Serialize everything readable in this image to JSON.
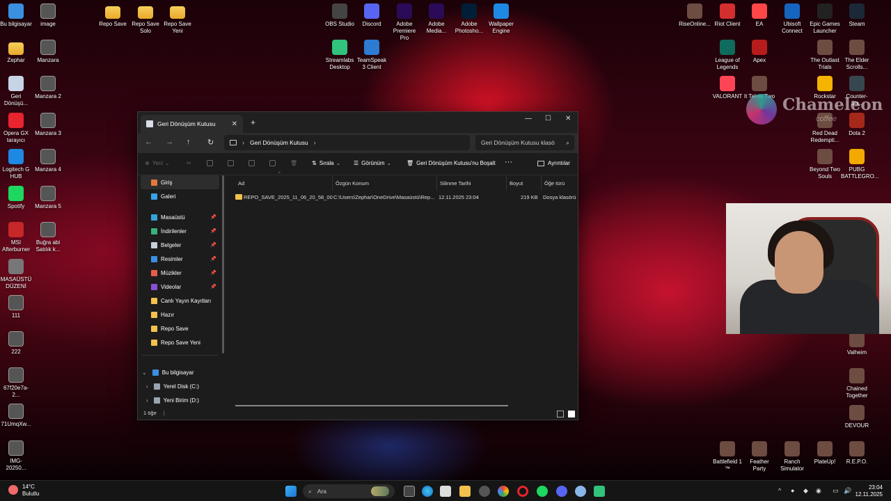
{
  "desktop": {
    "icons_left": [
      {
        "label": "Bu bilgisayar",
        "icon": "computer-icon"
      },
      {
        "label": "image",
        "icon": "image-icon"
      },
      {
        "label": "Zephar",
        "icon": "folder-icon"
      },
      {
        "label": "Manzara",
        "icon": "image-icon"
      },
      {
        "label": "Geri Dönüşü...",
        "icon": "recycle-bin-icon"
      },
      {
        "label": "Manzara 2",
        "icon": "image-icon"
      },
      {
        "label": "Opera GX tarayıcı",
        "icon": "opera-gx-icon"
      },
      {
        "label": "Manzara 3",
        "icon": "image-icon"
      },
      {
        "label": "Logitech G HUB",
        "icon": "logitech-icon"
      },
      {
        "label": "Manzara 4",
        "icon": "image-icon"
      },
      {
        "label": "Spotify",
        "icon": "spotify-icon"
      },
      {
        "label": "Manzara 5",
        "icon": "image-icon"
      },
      {
        "label": "MSI Afterburner",
        "icon": "msi-icon"
      },
      {
        "label": "Buğra abi Satılık k...",
        "icon": "image-icon"
      },
      {
        "label": "MASAÜSTÜ DÜZENİ",
        "icon": "shortcut-icon"
      },
      {
        "label": "111",
        "icon": "image-icon"
      },
      {
        "label": "222",
        "icon": "image-icon"
      },
      {
        "label": "67f20e7a-2...",
        "icon": "image-icon"
      },
      {
        "label": "71UmqXw...",
        "icon": "image-icon"
      },
      {
        "label": "IMG-20250...",
        "icon": "image-icon"
      }
    ],
    "icons_top": [
      {
        "label": "Repo Save",
        "icon": "folder-icon"
      },
      {
        "label": "Repo Save Solo",
        "icon": "folder-icon"
      },
      {
        "label": "Repo Save Yeni",
        "icon": "folder-icon"
      },
      {
        "label": "OBS Studio",
        "icon": "obs-icon"
      },
      {
        "label": "Discord",
        "icon": "discord-icon"
      },
      {
        "label": "Adobe Premiere Pro",
        "icon": "premiere-icon"
      },
      {
        "label": "Adobe Media...",
        "icon": "media-encoder-icon"
      },
      {
        "label": "Adobe Photosho...",
        "icon": "photoshop-icon"
      },
      {
        "label": "Wallpaper Engine",
        "icon": "wallpaper-engine-icon"
      },
      {
        "label": "Streamlabs Desktop",
        "icon": "streamlabs-icon"
      },
      {
        "label": "TeamSpeak 3 Client",
        "icon": "teamspeak-icon"
      }
    ],
    "icons_right": [
      {
        "label": "RiseOnline...",
        "icon": "game-icon"
      },
      {
        "label": "Riot Client",
        "icon": "riot-icon"
      },
      {
        "label": "EA",
        "icon": "ea-icon"
      },
      {
        "label": "Ubisoft Connect",
        "icon": "ubisoft-icon"
      },
      {
        "label": "Epic Games Launcher",
        "icon": "epic-icon"
      },
      {
        "label": "Steam",
        "icon": "steam-icon"
      },
      {
        "label": "League of Legends",
        "icon": "lol-icon"
      },
      {
        "label": "Apex",
        "icon": "apex-icon"
      },
      {
        "label": "The Outlast Trials",
        "icon": "game-icon"
      },
      {
        "label": "The Elder Scrolls...",
        "icon": "game-icon"
      },
      {
        "label": "VALORANT",
        "icon": "valorant-icon"
      },
      {
        "label": "It Takes Two",
        "icon": "game-icon"
      },
      {
        "label": "Rockstar",
        "icon": "rockstar-icon"
      },
      {
        "label": "Counter-Str...",
        "icon": "cs-icon"
      },
      {
        "label": "Red Dead Redempti...",
        "icon": "game-icon"
      },
      {
        "label": "Dota 2",
        "icon": "dota-icon"
      },
      {
        "label": "Beyond Two Souls",
        "icon": "game-icon"
      },
      {
        "label": "PUBG BATTLEGRO...",
        "icon": "pubg-icon"
      },
      {
        "label": "Valheim",
        "icon": "game-icon"
      },
      {
        "label": "Chained Together",
        "icon": "game-icon"
      },
      {
        "label": "DEVOUR",
        "icon": "game-icon"
      },
      {
        "label": "Battlefield 1 ™",
        "icon": "game-icon"
      },
      {
        "label": "Feather Party",
        "icon": "game-icon"
      },
      {
        "label": "Ranch Simulator",
        "icon": "game-icon"
      },
      {
        "label": "PlateUp!",
        "icon": "game-icon"
      },
      {
        "label": "R.E.P.O.",
        "icon": "game-icon"
      }
    ]
  },
  "overlay": {
    "brand": "Chameleon",
    "sub": "coffee"
  },
  "explorer": {
    "tab_title": "Geri Dönüşüm Kutusu",
    "address": "Geri Dönüşüm Kutusu",
    "search_placeholder": "Geri Dönüşüm Kutusu klasö",
    "toolbar": {
      "new": "Yeni",
      "sort": "Sırala",
      "view": "Görünüm",
      "empty": "Geri Dönüşüm Kutusu'nu Boşalt",
      "more": "···",
      "details": "Ayrıntılar"
    },
    "sidebar": [
      {
        "label": "Giriş",
        "color": "#e07a3b",
        "pin": false,
        "active": true
      },
      {
        "label": "Galeri",
        "color": "#3aa0e8",
        "pin": false
      },
      {
        "label": "Masaüstü",
        "color": "#33a3d8",
        "pin": true
      },
      {
        "label": "İndirilenler",
        "color": "#38b27a",
        "pin": true
      },
      {
        "label": "Belgeler",
        "color": "#c7cfd8",
        "pin": true
      },
      {
        "label": "Resimler",
        "color": "#3a8fe0",
        "pin": true
      },
      {
        "label": "Müzikler",
        "color": "#e85b4a",
        "pin": true
      },
      {
        "label": "Videolar",
        "color": "#8a4fd8",
        "pin": true
      },
      {
        "label": "Canlı Yayın Kayıtları",
        "color": "#f2c14e",
        "pin": false
      },
      {
        "label": "Hazır",
        "color": "#f2c14e",
        "pin": false
      },
      {
        "label": "Repo Save",
        "color": "#f2c14e",
        "pin": false
      },
      {
        "label": "Repo Save Yeni",
        "color": "#f2c14e",
        "pin": false
      }
    ],
    "tree": [
      {
        "label": "Bu bilgisayar",
        "chevron": "⌄"
      },
      {
        "label": "Yerel Disk (C:)",
        "chevron": "›"
      },
      {
        "label": "Yeni Birim (D:)",
        "chevron": "›"
      }
    ],
    "columns": [
      "Ad",
      "Özgün Konum",
      "Silinme Tarihi",
      "Boyut",
      "Öğe türü"
    ],
    "rows": [
      {
        "name": "REPO_SAVE_2025_11_06_20_58_00",
        "location": "C:\\Users\\Zephar\\OneDrive\\Masaüstü\\Rep...",
        "deleted": "12.11.2025 23:04",
        "size": "219 KB",
        "type": "Dosya klasörü"
      }
    ],
    "status": "1 öğe"
  },
  "taskbar": {
    "weather_temp": "14°C",
    "weather_desc": "Bulutlu",
    "search": "Ara",
    "time": "23:04",
    "date": "12.11.2025"
  }
}
